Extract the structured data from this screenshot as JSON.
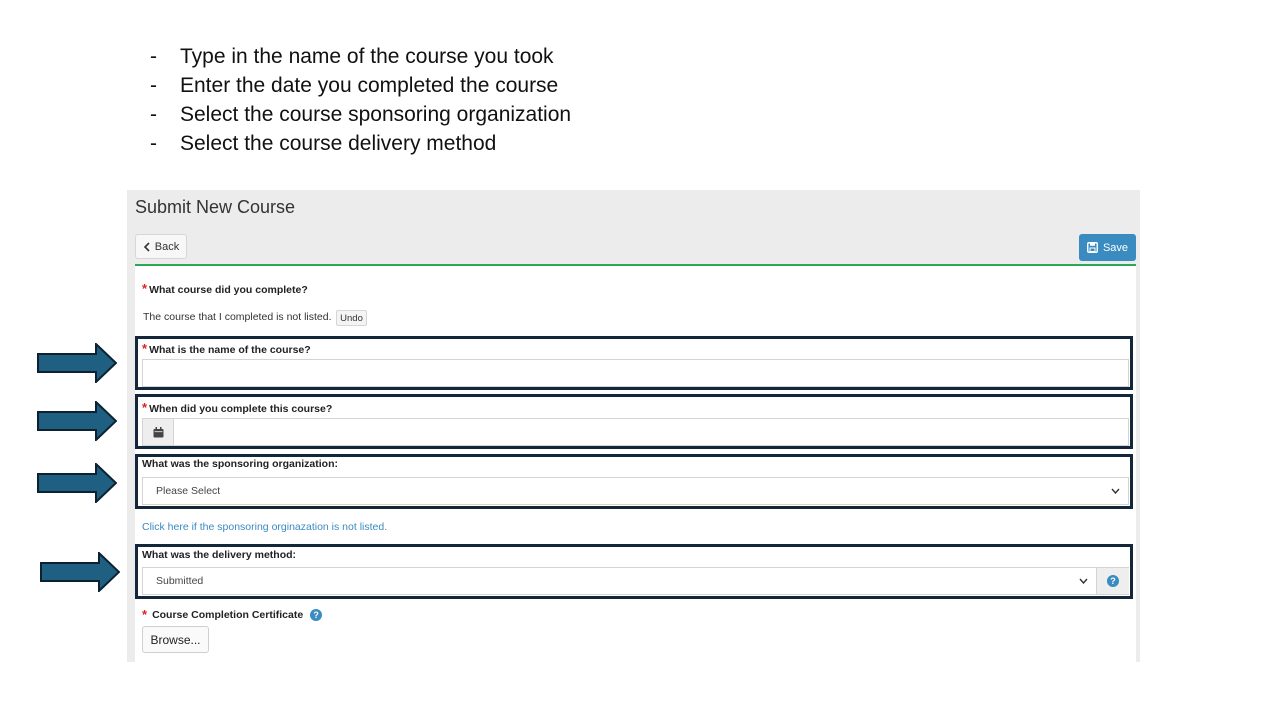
{
  "instructions": [
    "Type in the name of the course you took",
    "Enter the date you completed the course",
    "Select the course sponsoring organization",
    "Select the course delivery method"
  ],
  "bullet_marker": "-",
  "panel": {
    "title": "Submit New Course",
    "back_label": "Back",
    "save_label": "Save"
  },
  "form": {
    "required_marker": "*",
    "course_question": "What course did you complete?",
    "not_listed_note": "The course that I completed is not listed.",
    "undo_label": "Undo",
    "course_name_label": "What is the name of the course?",
    "course_name_value": "",
    "completion_date_label": "When did you complete this course?",
    "completion_date_value": "",
    "sponsor_label": "What was the sponsoring organization:",
    "sponsor_selected": "Please Select",
    "sponsor_not_listed_link": "Click here if the sponsoring orginazation is not listed.",
    "delivery_label": "What was the delivery method:",
    "delivery_selected": "Submitted",
    "certificate_label": "Course Completion Certificate",
    "browse_label": "Browse...",
    "help_glyph": "?"
  },
  "colors": {
    "arrow_fill": "#1f5f82",
    "arrow_stroke": "#0d2230",
    "highlight_border": "#13263a",
    "save_button": "#3a8bc0",
    "accent_rule": "#2aa857",
    "required": "#e02020"
  }
}
